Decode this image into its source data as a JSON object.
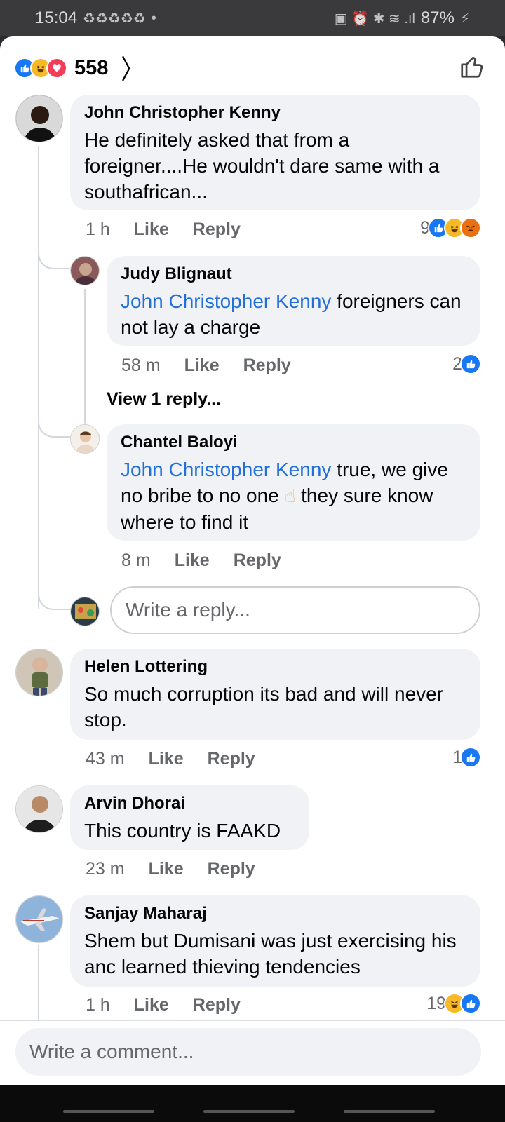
{
  "status_bar": {
    "time": "15:04",
    "notif_icons": "♻♻♻♻♻",
    "dot": "•",
    "sys_icons": "▣ ⏰ ✱ ≋ .ıl",
    "battery": "87%",
    "battery_icon": "⚡"
  },
  "header": {
    "reaction_count": "558",
    "chevron": "〉",
    "like_icon_glyph": "👍"
  },
  "comments": [
    {
      "name": "John Christopher Kenny",
      "text": "He definitely asked that from a foreigner....He wouldn't dare same with a southafrican...",
      "time": "1 h",
      "like": "Like",
      "reply": "Reply",
      "reaction_count": "9",
      "reactions": [
        "like-icon",
        "haha-icon",
        "angry-icon"
      ]
    },
    {
      "name": "Judy Blignaut",
      "mention": "John Christopher Kenny",
      "text": " foreigners can not lay a charge",
      "time": "58 m",
      "like": "Like",
      "reply": "Reply",
      "reaction_count": "2",
      "reactions": [
        "like-icon"
      ],
      "view_replies": "View 1 reply..."
    },
    {
      "name": "Chantel Baloyi",
      "mention": "John Christopher Kenny",
      "text_a": " true, we give no bribe to no one ",
      "emoji": "☝",
      "text_b": " they sure know where to find it",
      "time": "8 m",
      "like": "Like",
      "reply": "Reply"
    },
    {
      "name": "Helen Lottering",
      "text": "So much corruption its bad and will never stop.",
      "time": "43 m",
      "like": "Like",
      "reply": "Reply",
      "reaction_count": "1",
      "reactions": [
        "like-icon"
      ]
    },
    {
      "name": "Arvin Dhorai",
      "text": "This country is FAAKD",
      "time": "23 m",
      "like": "Like",
      "reply": "Reply"
    },
    {
      "name": "Sanjay Maharaj",
      "text": "Shem but Dumisani was just exercising his anc learned thieving tendencies",
      "time": "1 h",
      "like": "Like",
      "reply": "Reply",
      "reaction_count": "19",
      "reactions": [
        "haha-icon",
        "like-icon"
      ]
    }
  ],
  "reply_input": {
    "placeholder": "Write a reply..."
  },
  "comment_input": {
    "placeholder": "Write a comment..."
  },
  "colors": {
    "accent": "#1877f2",
    "bubble": "#f0f2f5",
    "mention": "#216fdb",
    "meta": "#65676b"
  }
}
